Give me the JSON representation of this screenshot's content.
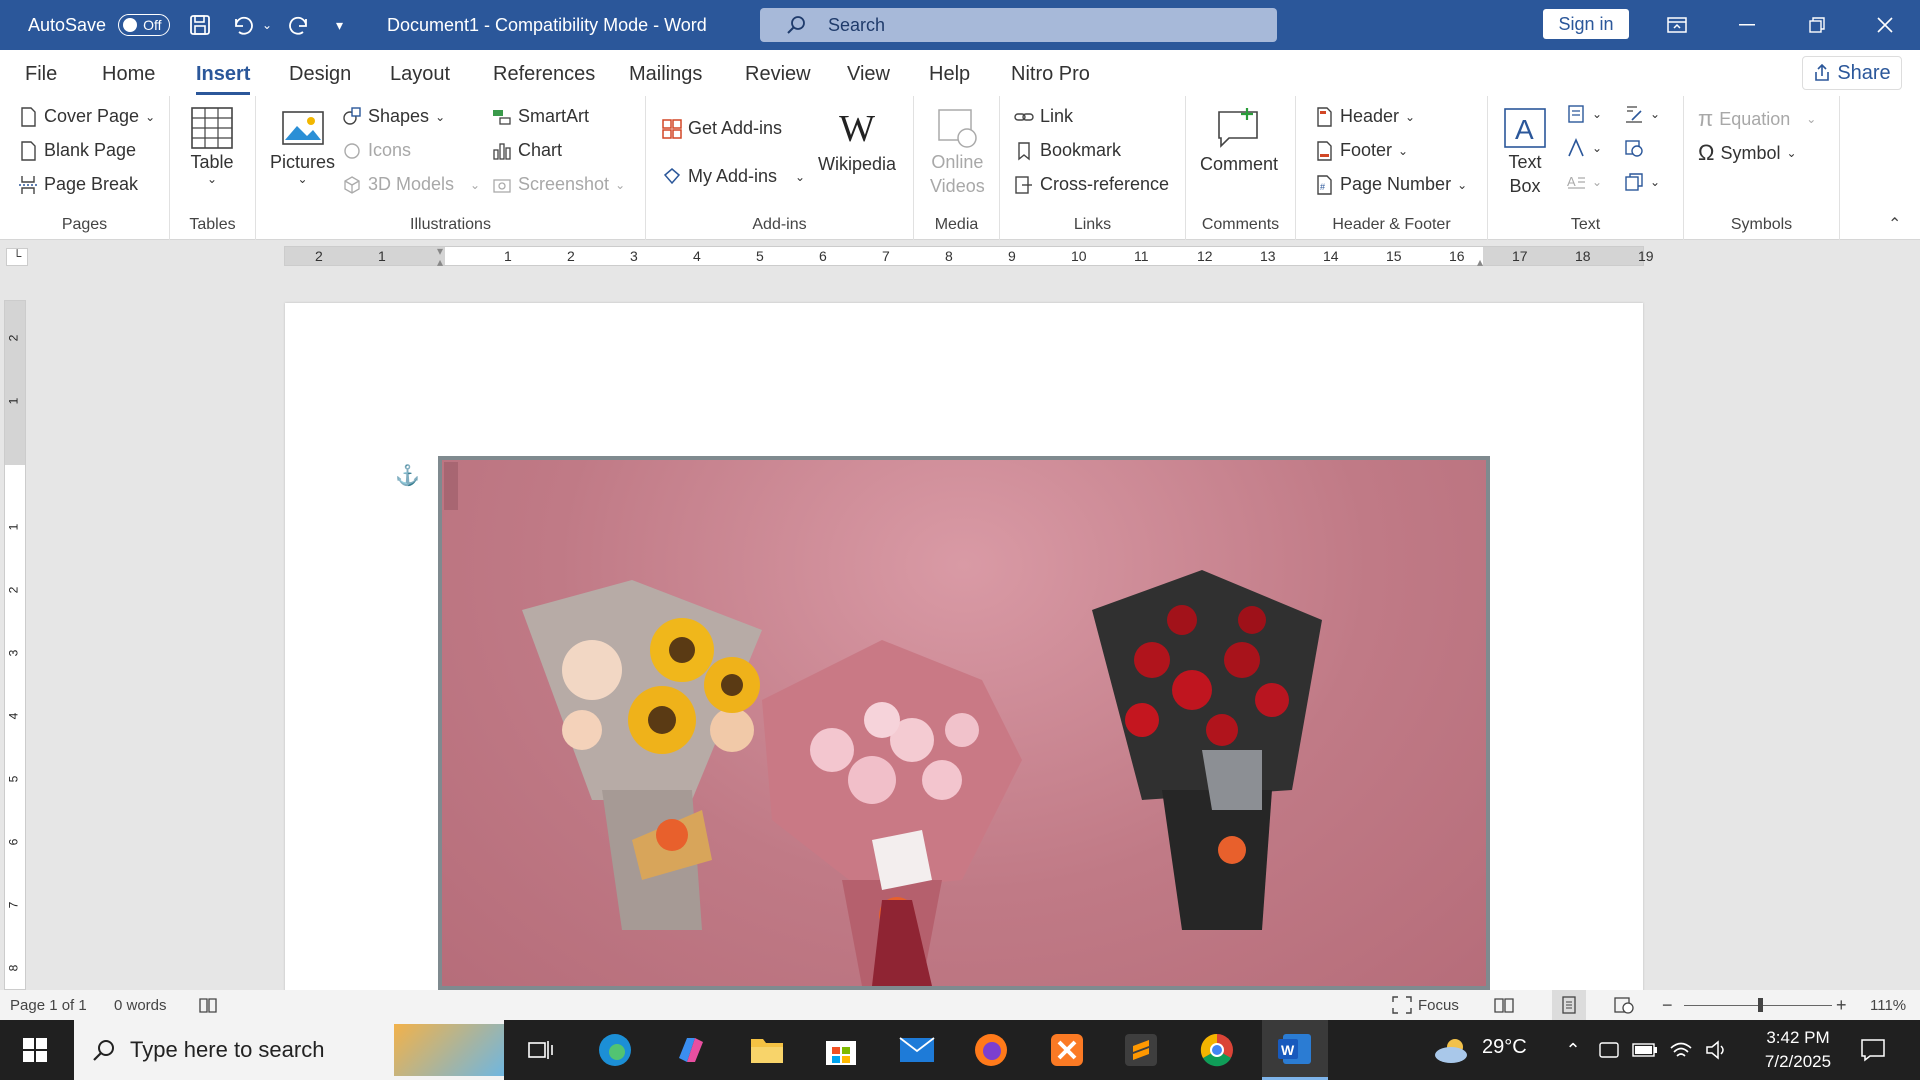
{
  "titlebar": {
    "autosave_label": "AutoSave",
    "autosave_state": "Off",
    "doc_title": "Document1  -  Compatibility Mode  -  Word",
    "search_placeholder": "Search",
    "signin": "Sign in"
  },
  "menu": {
    "tabs": [
      "File",
      "Home",
      "Insert",
      "Design",
      "Layout",
      "References",
      "Mailings",
      "Review",
      "View",
      "Help",
      "Nitro Pro"
    ],
    "active": "Insert",
    "share": "Share"
  },
  "ribbon": {
    "pages": {
      "label": "Pages",
      "cover_page": "Cover Page",
      "blank_page": "Blank Page",
      "page_break": "Page Break"
    },
    "tables": {
      "label": "Tables",
      "table": "Table"
    },
    "illustrations": {
      "label": "Illustrations",
      "pictures": "Pictures",
      "shapes": "Shapes",
      "icons": "Icons",
      "models": "3D Models",
      "smartart": "SmartArt",
      "chart": "Chart",
      "screenshot": "Screenshot"
    },
    "addins": {
      "label": "Add-ins",
      "get": "Get Add-ins",
      "my": "My Add-ins",
      "wikipedia": "Wikipedia"
    },
    "media": {
      "label": "Media",
      "online_videos_1": "Online",
      "online_videos_2": "Videos"
    },
    "links": {
      "label": "Links",
      "link": "Link",
      "bookmark": "Bookmark",
      "cross_reference": "Cross-reference"
    },
    "comments": {
      "label": "Comments",
      "comment": "Comment"
    },
    "header_footer": {
      "label": "Header & Footer",
      "header": "Header",
      "footer": "Footer",
      "page_number": "Page Number"
    },
    "text": {
      "label": "Text",
      "text_box_1": "Text",
      "text_box_2": "Box"
    },
    "symbols": {
      "label": "Symbols",
      "equation": "Equation",
      "symbol": "Symbol"
    }
  },
  "ruler": {
    "ticks": [
      "2",
      "1",
      "",
      "1",
      "2",
      "3",
      "4",
      "5",
      "6",
      "7",
      "8",
      "9",
      "10",
      "11",
      "12",
      "13",
      "14",
      "15",
      "16",
      "17",
      "18",
      "19"
    ]
  },
  "vruler": {
    "ticks": [
      "2",
      "1",
      "",
      "1",
      "2",
      "3",
      "4",
      "5",
      "6",
      "7",
      "8"
    ]
  },
  "statusbar": {
    "page": "Page 1 of 1",
    "words": "0 words",
    "focus": "Focus",
    "zoom": "111%"
  },
  "taskbar": {
    "search_placeholder": "Type here to search",
    "temperature": "29°C",
    "time": "3:42 PM",
    "date": "7/2/2025"
  },
  "colors": {
    "word_blue": "#2b579a",
    "picture_bg": "#c07a86"
  }
}
